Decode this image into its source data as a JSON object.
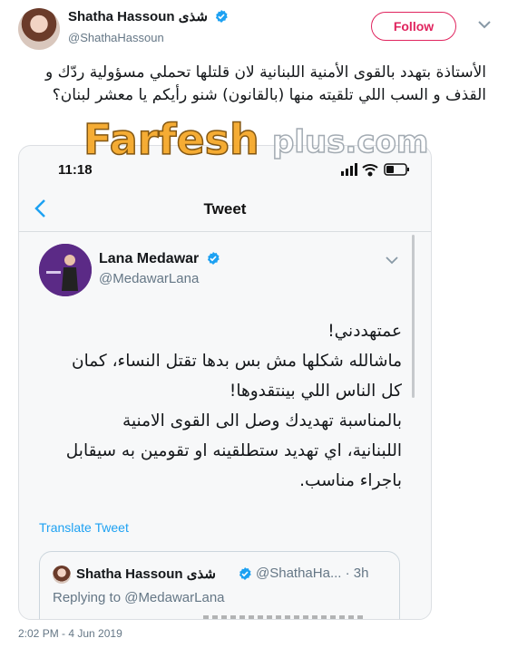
{
  "author": {
    "name": "Shatha Hassoun شذى",
    "handle": "@ShathaHassoun"
  },
  "follow_label": "Follow",
  "tweet_text": "الأستاذة بتهدد بالقوى الأمنية اللبنانية لان قلتلها تحملي مسؤولية ردّك و القذف و السب اللي تلقيته منها (بالقانون) شنو رأيكم يا معشر لبنان؟",
  "watermark": {
    "brand": "Farfesh",
    "suffix": "plus.com"
  },
  "screenshot": {
    "status_time": "11:18",
    "nav_title": "Tweet",
    "inner_tweet": {
      "name": "Lana Medawar",
      "handle": "@MedawarLana",
      "lines": [
        "عمتهددني!",
        "ماشالله شكلها مش بس بدها تقتل النساء، كمان",
        "كل الناس اللي بينتقدوها!",
        "بالمناسبة تهديدك وصل الى القوى الامنية",
        "اللبنانية، اي تهديد ستطلقينه او تقومين به سيقابل",
        "باجراء مناسب."
      ],
      "translate_label": "Translate Tweet"
    },
    "quoted_tweet": {
      "name": "Shatha Hassoun شذى",
      "handle": "@ShathaHa...",
      "time": "· 3h",
      "reply_text": "Replying to @MedawarLana"
    }
  },
  "timestamp": "2:02 PM - 4 Jun 2019",
  "colors": {
    "verified": "#1da1f2",
    "follow": "#e0245e",
    "link": "#1da1f2",
    "watermark_orange": "#f5a623"
  },
  "icons": {
    "verified": "verified-badge-icon",
    "caret": "chevron-down-icon",
    "back": "chevron-left-icon",
    "signal": "signal-icon",
    "wifi": "wifi-icon",
    "battery": "battery-icon"
  }
}
